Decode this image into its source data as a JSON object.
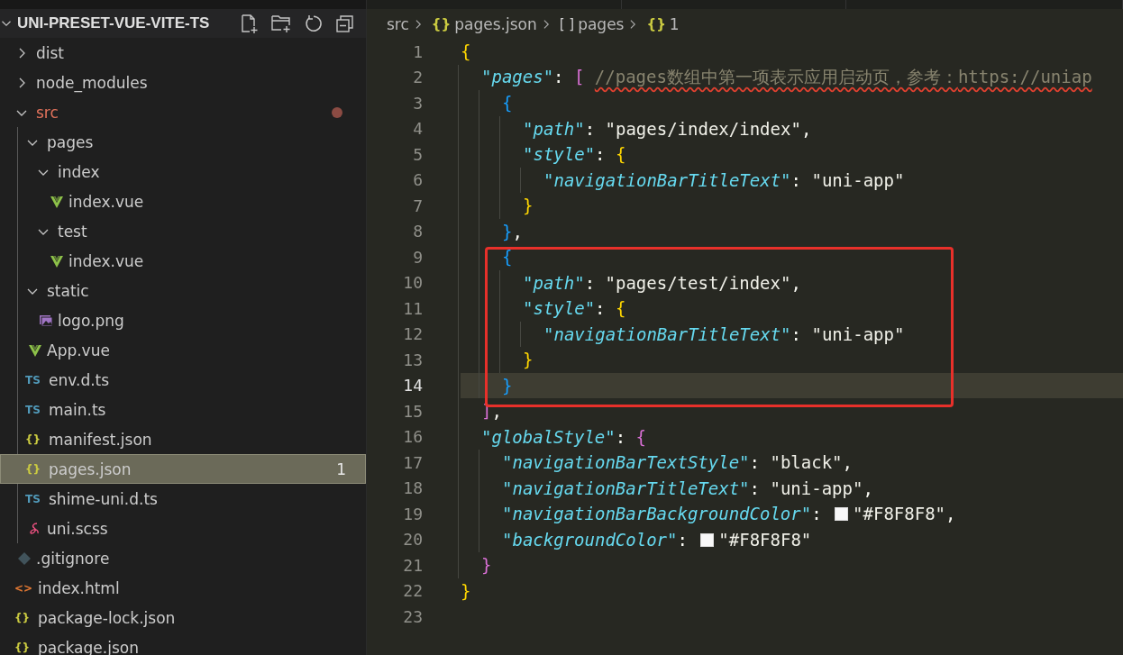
{
  "explorer": {
    "title": "UNI-PRESET-VUE-VITE-TS",
    "expanded": true,
    "items": [
      {
        "name": "dist",
        "kind": "folder",
        "expanded": false,
        "selected": false,
        "modified": false
      },
      {
        "name": "node_modules",
        "kind": "folder",
        "expanded": false,
        "selected": false,
        "modified": false
      },
      {
        "name": "src",
        "kind": "folder",
        "expanded": true,
        "selected": false,
        "modified": true,
        "children": [
          {
            "name": "pages",
            "kind": "folder",
            "expanded": true,
            "selected": false,
            "modified": false,
            "children": [
              {
                "name": "index",
                "kind": "folder",
                "expanded": true,
                "selected": false,
                "modified": false,
                "children": [
                  {
                    "name": "index.vue",
                    "kind": "vue",
                    "selected": false,
                    "modified": false
                  }
                ]
              },
              {
                "name": "test",
                "kind": "folder",
                "expanded": true,
                "selected": false,
                "modified": false,
                "children": [
                  {
                    "name": "index.vue",
                    "kind": "vue",
                    "selected": false,
                    "modified": false
                  }
                ]
              }
            ]
          },
          {
            "name": "static",
            "kind": "folder",
            "expanded": true,
            "selected": false,
            "modified": false,
            "children": [
              {
                "name": "logo.png",
                "kind": "image",
                "selected": false,
                "modified": false
              }
            ]
          },
          {
            "name": "App.vue",
            "kind": "vue",
            "selected": false,
            "modified": false
          },
          {
            "name": "env.d.ts",
            "kind": "ts",
            "icon_label": "TS",
            "selected": false,
            "modified": false
          },
          {
            "name": "main.ts",
            "kind": "ts",
            "icon_label": "TS",
            "selected": false,
            "modified": false
          },
          {
            "name": "manifest.json",
            "kind": "json",
            "icon_label": "{}",
            "selected": false,
            "modified": false
          },
          {
            "name": "pages.json",
            "kind": "json",
            "icon_label": "{}",
            "selected": true,
            "modified": false,
            "badge": "1"
          },
          {
            "name": "shime-uni.d.ts",
            "kind": "ts",
            "icon_label": "TS",
            "selected": false,
            "modified": false
          },
          {
            "name": "uni.scss",
            "kind": "scss",
            "selected": false,
            "modified": false
          }
        ]
      },
      {
        "name": ".gitignore",
        "kind": "git",
        "selected": false,
        "modified": false
      },
      {
        "name": "index.html",
        "kind": "html",
        "icon_label": "<>",
        "selected": false,
        "modified": false
      },
      {
        "name": "package-lock.json",
        "kind": "json",
        "icon_label": "{}",
        "selected": false,
        "modified": false
      },
      {
        "name": "package.json",
        "kind": "json",
        "icon_label": "{}",
        "selected": false,
        "modified": false
      }
    ]
  },
  "breadcrumb": [
    {
      "label": "src"
    },
    {
      "icon_label": "{}",
      "label": "pages.json"
    },
    {
      "icon_label": "[ ]",
      "label": "pages"
    },
    {
      "icon_label": "{}",
      "label": "1"
    }
  ],
  "editor": {
    "lines": [
      {
        "number": "1",
        "selected": false,
        "boxed": false,
        "tokens": [
          {
            "kind": "open",
            "t": "{"
          }
        ]
      },
      {
        "number": "2",
        "selected": false,
        "boxed": false,
        "tokens": [
          {
            "kind": "key",
            "t": "\"pages\""
          },
          {
            "kind": "punct",
            "t": ": "
          },
          {
            "kind": "open",
            "t": "["
          },
          {
            "kind": "comment",
            "t": "//pages数组中第一项表示应用启动页，参考：",
            "error": true
          },
          {
            "kind": "link",
            "t": "https://uniap",
            "error": true
          }
        ]
      },
      {
        "number": "3",
        "selected": false,
        "boxed": false,
        "tokens": [
          {
            "kind": "open",
            "t": "{"
          }
        ]
      },
      {
        "number": "4",
        "selected": false,
        "boxed": false,
        "tokens": [
          {
            "kind": "key",
            "t": "\"path\""
          },
          {
            "kind": "punct",
            "t": ": "
          },
          {
            "kind": "str",
            "t": "\"pages/index/index\""
          },
          {
            "kind": "punct",
            "t": ","
          }
        ]
      },
      {
        "number": "5",
        "selected": false,
        "boxed": false,
        "tokens": [
          {
            "kind": "key",
            "t": "\"style\""
          },
          {
            "kind": "punct",
            "t": ": "
          },
          {
            "kind": "open",
            "t": "{"
          }
        ]
      },
      {
        "number": "6",
        "selected": false,
        "boxed": false,
        "tokens": [
          {
            "kind": "key",
            "t": "\"navigationBarTitleText\""
          },
          {
            "kind": "punct",
            "t": ": "
          },
          {
            "kind": "str",
            "t": "\"uni-app\""
          }
        ]
      },
      {
        "number": "7",
        "selected": false,
        "boxed": false,
        "tokens": [
          {
            "kind": "close",
            "t": "}"
          }
        ]
      },
      {
        "number": "8",
        "selected": false,
        "boxed": false,
        "tokens": [
          {
            "kind": "close",
            "t": "}"
          },
          {
            "kind": "punct",
            "t": ","
          }
        ]
      },
      {
        "number": "9",
        "selected": false,
        "boxed": true,
        "tokens": [
          {
            "kind": "open",
            "t": "{"
          }
        ]
      },
      {
        "number": "10",
        "selected": false,
        "boxed": true,
        "tokens": [
          {
            "kind": "key",
            "t": "\"path\""
          },
          {
            "kind": "punct",
            "t": ": "
          },
          {
            "kind": "str",
            "t": "\"pages/test/index\""
          },
          {
            "kind": "punct",
            "t": ","
          }
        ]
      },
      {
        "number": "11",
        "selected": false,
        "boxed": true,
        "tokens": [
          {
            "kind": "key",
            "t": "\"style\""
          },
          {
            "kind": "punct",
            "t": ": "
          },
          {
            "kind": "open",
            "t": "{"
          }
        ]
      },
      {
        "number": "12",
        "selected": false,
        "boxed": true,
        "tokens": [
          {
            "kind": "key",
            "t": "\"navigationBarTitleText\""
          },
          {
            "kind": "punct",
            "t": ": "
          },
          {
            "kind": "str",
            "t": "\"uni-app\""
          }
        ]
      },
      {
        "number": "13",
        "selected": false,
        "boxed": true,
        "tokens": [
          {
            "kind": "close",
            "t": "}"
          }
        ]
      },
      {
        "number": "14",
        "selected": true,
        "boxed": true,
        "tokens": [
          {
            "kind": "close",
            "t": "}"
          }
        ]
      },
      {
        "number": "15",
        "selected": false,
        "boxed": false,
        "tokens": [
          {
            "kind": "close",
            "t": "]"
          },
          {
            "kind": "punct",
            "t": ","
          }
        ]
      },
      {
        "number": "16",
        "selected": false,
        "boxed": false,
        "tokens": [
          {
            "kind": "key",
            "t": "\"globalStyle\""
          },
          {
            "kind": "punct",
            "t": ": "
          },
          {
            "kind": "open",
            "t": "{"
          }
        ]
      },
      {
        "number": "17",
        "selected": false,
        "boxed": false,
        "tokens": [
          {
            "kind": "key",
            "t": "\"navigationBarTextStyle\""
          },
          {
            "kind": "punct",
            "t": ": "
          },
          {
            "kind": "str",
            "t": "\"black\""
          },
          {
            "kind": "punct",
            "t": ","
          }
        ]
      },
      {
        "number": "18",
        "selected": false,
        "boxed": false,
        "tokens": [
          {
            "kind": "key",
            "t": "\"navigationBarTitleText\""
          },
          {
            "kind": "punct",
            "t": ": "
          },
          {
            "kind": "str",
            "t": "\"uni-app\""
          },
          {
            "kind": "punct",
            "t": ","
          }
        ]
      },
      {
        "number": "19",
        "selected": false,
        "boxed": false,
        "tokens": [
          {
            "kind": "key",
            "t": "\"navigationBarBackgroundColor\""
          },
          {
            "kind": "punct",
            "t": ": "
          },
          {
            "kind": "swatch",
            "color": "#f8f8f8"
          },
          {
            "kind": "str",
            "t": "\"#F8F8F8\""
          },
          {
            "kind": "punct",
            "t": ","
          }
        ]
      },
      {
        "number": "20",
        "selected": false,
        "boxed": false,
        "tokens": [
          {
            "kind": "key",
            "t": "\"backgroundColor\""
          },
          {
            "kind": "punct",
            "t": ": "
          },
          {
            "kind": "swatch",
            "color": "#f8f8f8"
          },
          {
            "kind": "str",
            "t": "\"#F8F8F8\""
          }
        ]
      },
      {
        "number": "21",
        "selected": false,
        "boxed": false,
        "tokens": [
          {
            "kind": "close",
            "t": "}"
          }
        ]
      },
      {
        "number": "22",
        "selected": false,
        "boxed": false,
        "tokens": [
          {
            "kind": "close",
            "t": "}"
          }
        ]
      },
      {
        "number": "23",
        "selected": false,
        "boxed": false
      }
    ]
  }
}
